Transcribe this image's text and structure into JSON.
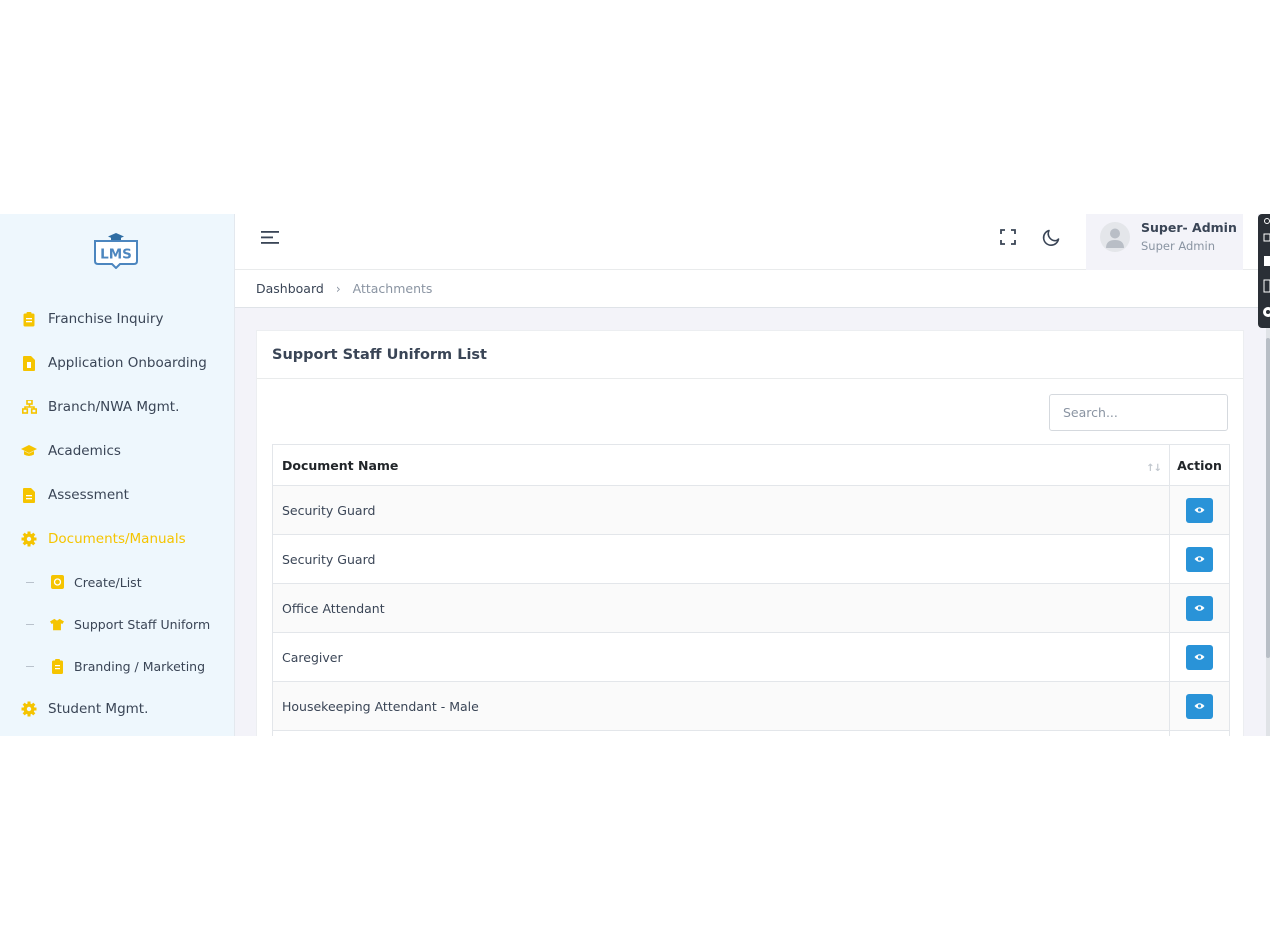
{
  "app": {
    "logo_text": "LMS"
  },
  "sidebar": {
    "items": [
      {
        "label": "Franchise Inquiry",
        "icon": "clipboard-icon",
        "active": false
      },
      {
        "label": "Application Onboarding",
        "icon": "file-icon",
        "active": false
      },
      {
        "label": "Branch/NWA Mgmt.",
        "icon": "sitemap-icon",
        "active": false
      },
      {
        "label": "Academics",
        "icon": "graduation-cap-icon",
        "active": false
      },
      {
        "label": "Assessment",
        "icon": "document-icon",
        "active": false
      },
      {
        "label": "Documents/Manuals",
        "icon": "gear-icon",
        "active": true
      }
    ],
    "sub_items": [
      {
        "label": "Create/List",
        "icon": "list-icon"
      },
      {
        "label": "Support Staff Uniform",
        "icon": "shirt-icon"
      },
      {
        "label": "Branding / Marketing",
        "icon": "clipboard-icon"
      }
    ],
    "after_items": [
      {
        "label": "Student Mgmt.",
        "icon": "gear-icon"
      }
    ]
  },
  "topbar": {
    "user_name": "Super- Admin",
    "user_role": "Super Admin"
  },
  "breadcrumb": {
    "home": "Dashboard",
    "current": "Attachments"
  },
  "card": {
    "title": "Support Staff Uniform List",
    "search_placeholder": "Search..."
  },
  "table": {
    "columns": [
      "Document Name",
      "Action"
    ],
    "rows": [
      "Security Guard",
      "Security Guard",
      "Office Attendant",
      "Caregiver",
      "Housekeeping Attendant - Male"
    ]
  },
  "colors": {
    "accent_yellow": "#f5c400",
    "view_button": "#2993d8",
    "sidebar_bg": "#eef7fd"
  }
}
